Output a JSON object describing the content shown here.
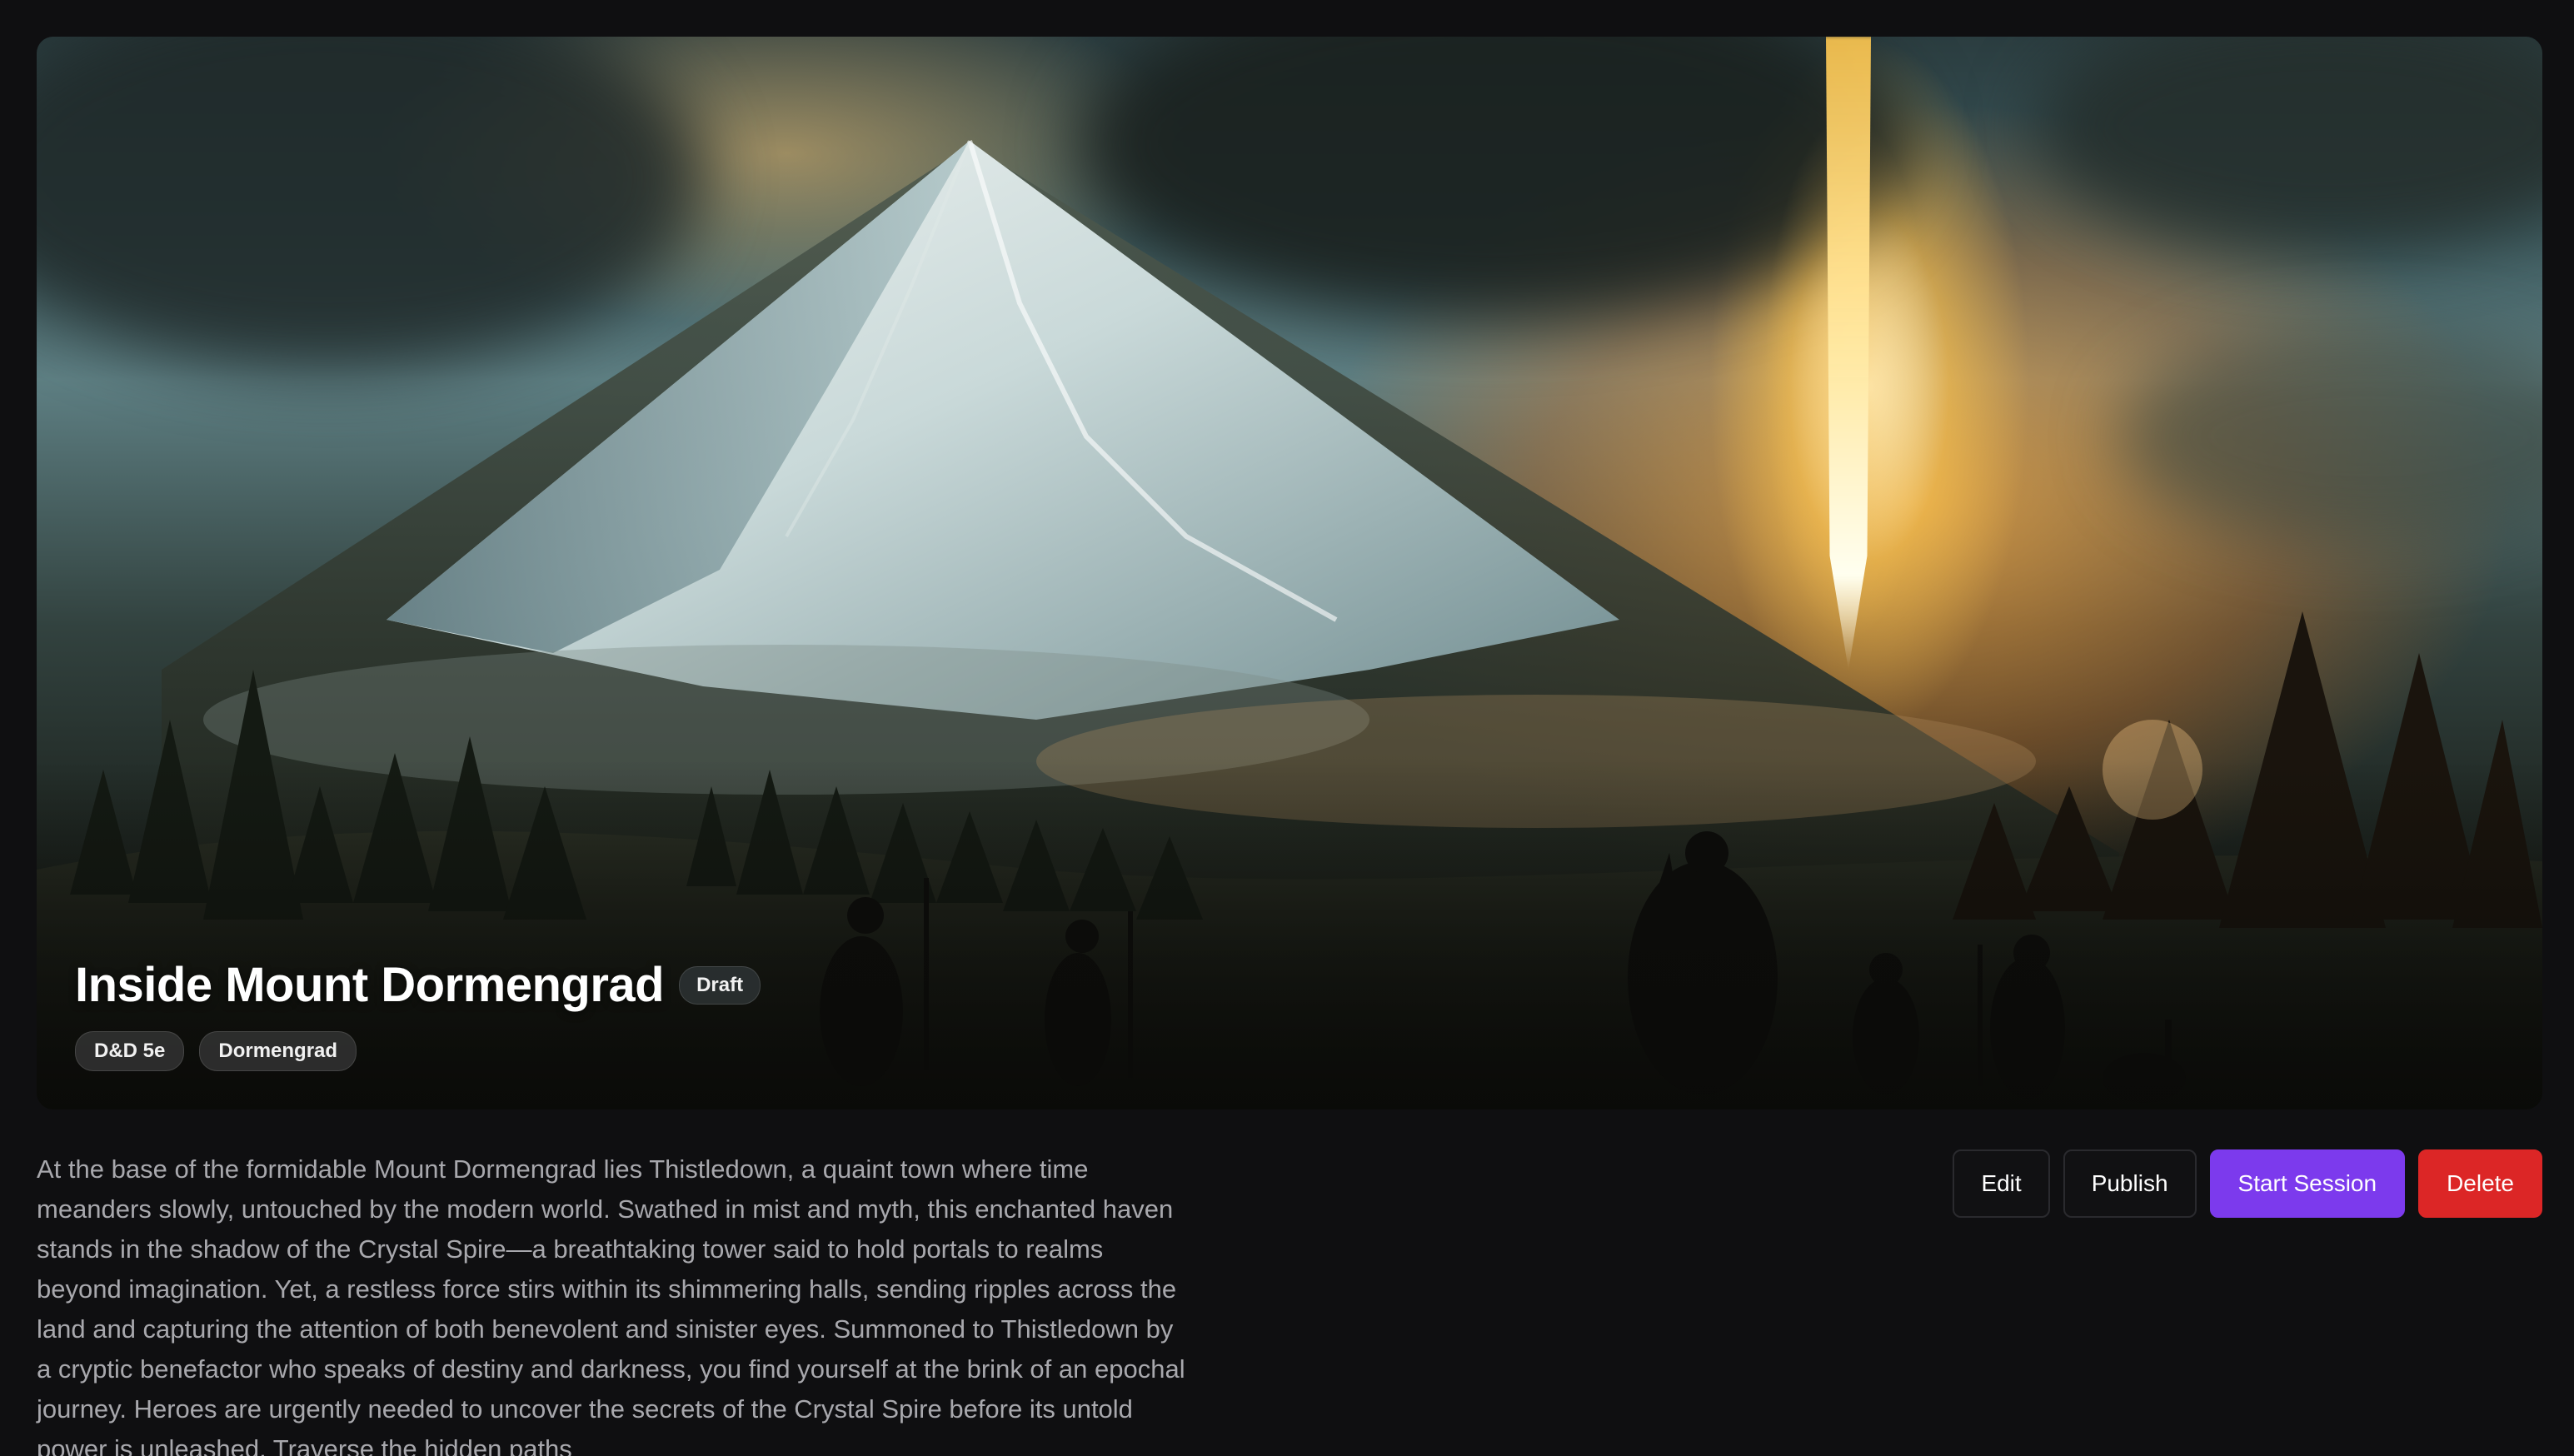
{
  "campaign": {
    "title": "Inside Mount Dormengrad",
    "status": "Draft",
    "tags": [
      "D&D 5e",
      "Dormengrad"
    ],
    "description": "At the base of the formidable Mount Dormengrad lies Thistledown, a quaint town where time meanders slowly, untouched by the modern world. Swathed in mist and myth, this enchanted haven stands in the shadow of the Crystal Spire—a breathtaking tower said to hold portals to realms beyond imagination. Yet, a restless force stirs within its shimmering halls, sending ripples across the land and capturing the attention of both benevolent and sinister eyes. Summoned to Thistledown by a cryptic benefactor who speaks of destiny and darkness, you find yourself at the brink of an epochal journey. Heroes are urgently needed to uncover the secrets of the Crystal Spire before its untold power is unleashed. Traverse the hidden paths"
  },
  "actions": {
    "edit": "Edit",
    "publish": "Publish",
    "start_session": "Start Session",
    "delete": "Delete"
  },
  "colors": {
    "background": "#0f0f11",
    "primary": "#7c3aed",
    "danger": "#dc2626",
    "text_muted": "#a8a8ad"
  }
}
